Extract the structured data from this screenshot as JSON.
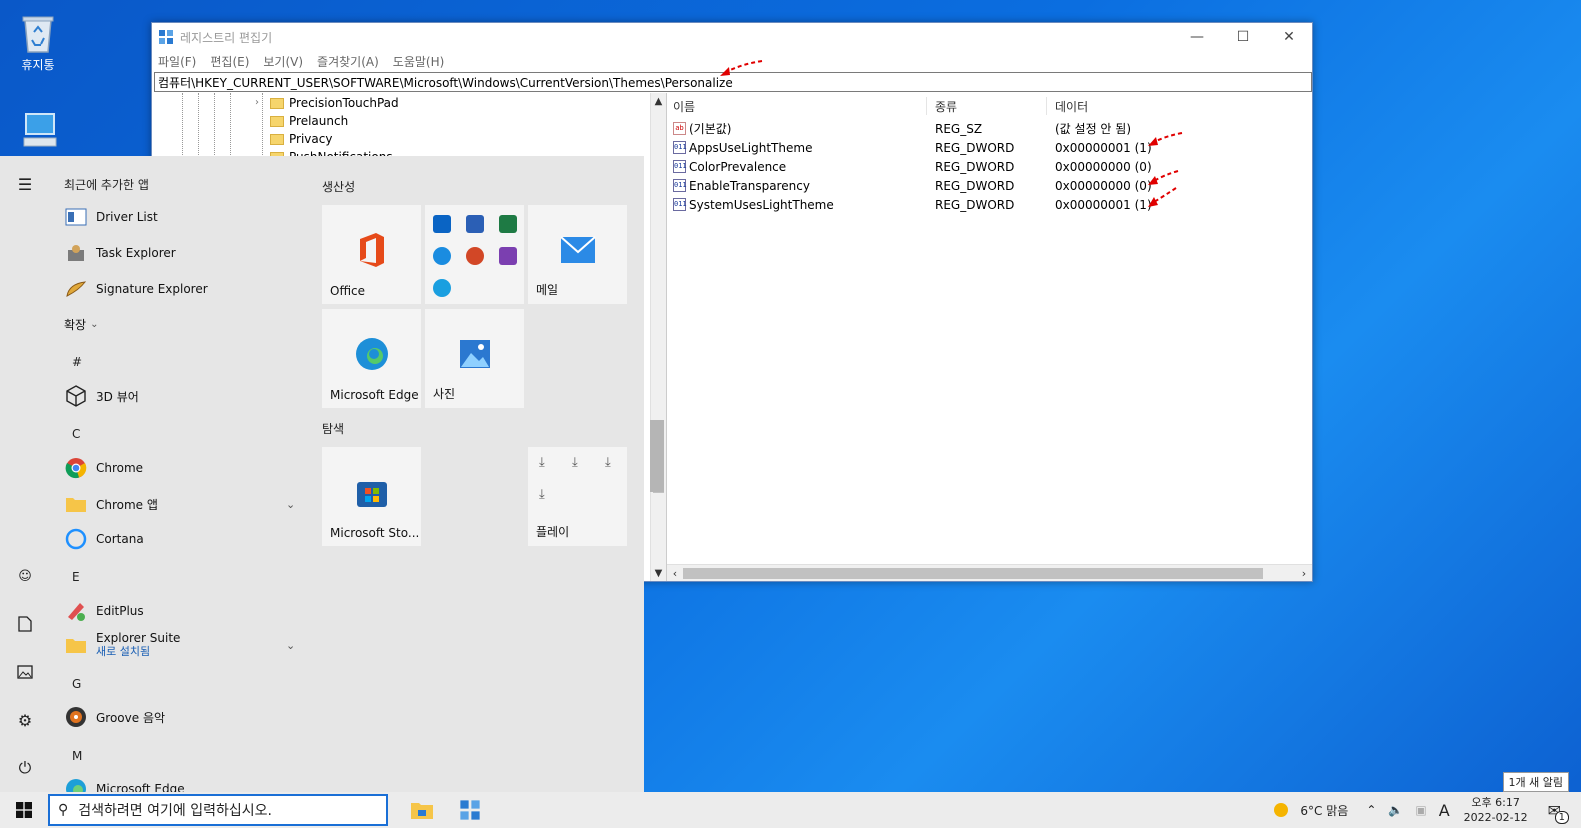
{
  "desktop": {
    "recycle_bin_label": "휴지통"
  },
  "regedit": {
    "title": "레지스트리 편집기",
    "menu": [
      "파일(F)",
      "편집(E)",
      "보기(V)",
      "즐겨찾기(A)",
      "도움말(H)"
    ],
    "address": "컴퓨터\\HKEY_CURRENT_USER\\SOFTWARE\\Microsoft\\Windows\\CurrentVersion\\Themes\\Personalize",
    "tree": [
      "PrecisionTouchPad",
      "Prelaunch",
      "Privacy",
      "PushNotifications"
    ],
    "columns": {
      "name": "이름",
      "type": "종류",
      "data": "데이터"
    },
    "values": [
      {
        "name": "(기본값)",
        "type": "REG_SZ",
        "data": "(값 설정 안 됨)",
        "icon": "ab"
      },
      {
        "name": "AppsUseLightTheme",
        "type": "REG_DWORD",
        "data": "0x00000001 (1)",
        "icon": "dword"
      },
      {
        "name": "ColorPrevalence",
        "type": "REG_DWORD",
        "data": "0x00000000 (0)",
        "icon": "dword"
      },
      {
        "name": "EnableTransparency",
        "type": "REG_DWORD",
        "data": "0x00000000 (0)",
        "icon": "dword"
      },
      {
        "name": "SystemUsesLightTheme",
        "type": "REG_DWORD",
        "data": "0x00000001 (1)",
        "icon": "dword"
      }
    ]
  },
  "startmenu": {
    "recent_header": "최근에 추가한 앱",
    "recent": [
      "Driver List",
      "Task Explorer",
      "Signature Explorer"
    ],
    "expand_label": "확장",
    "groups": [
      {
        "letter": "#",
        "apps": [
          "3D 뷰어"
        ]
      },
      {
        "letter": "C",
        "apps": [
          "Chrome",
          "Chrome 앱",
          "Cortana"
        ]
      },
      {
        "letter": "E",
        "apps": [
          "EditPlus",
          "Explorer Suite"
        ]
      },
      {
        "letter": "G",
        "apps": [
          "Groove 음악"
        ]
      },
      {
        "letter": "M",
        "apps": [
          "Microsoft Edge"
        ]
      }
    ],
    "explorer_suite_sub": "새로 설치됨",
    "sections": {
      "productivity": "생산성",
      "explore": "탐색"
    },
    "tiles": {
      "office": "Office",
      "mail": "메일",
      "edge": "Microsoft Edge",
      "photos": "사진",
      "store": "Microsoft Sto...",
      "play": "플레이"
    }
  },
  "taskbar": {
    "search_placeholder": "검색하려면 여기에 입력하십시오.",
    "weather": "6°C 맑음",
    "ime": "A",
    "time": "오후 6:17",
    "date": "2022-02-12",
    "notification_popup": "1개 새 알림",
    "notification_count": "1"
  },
  "colors": {
    "accent": "#1a6fd6",
    "arrow_red": "#e00000",
    "folder": "#f6d56c"
  }
}
